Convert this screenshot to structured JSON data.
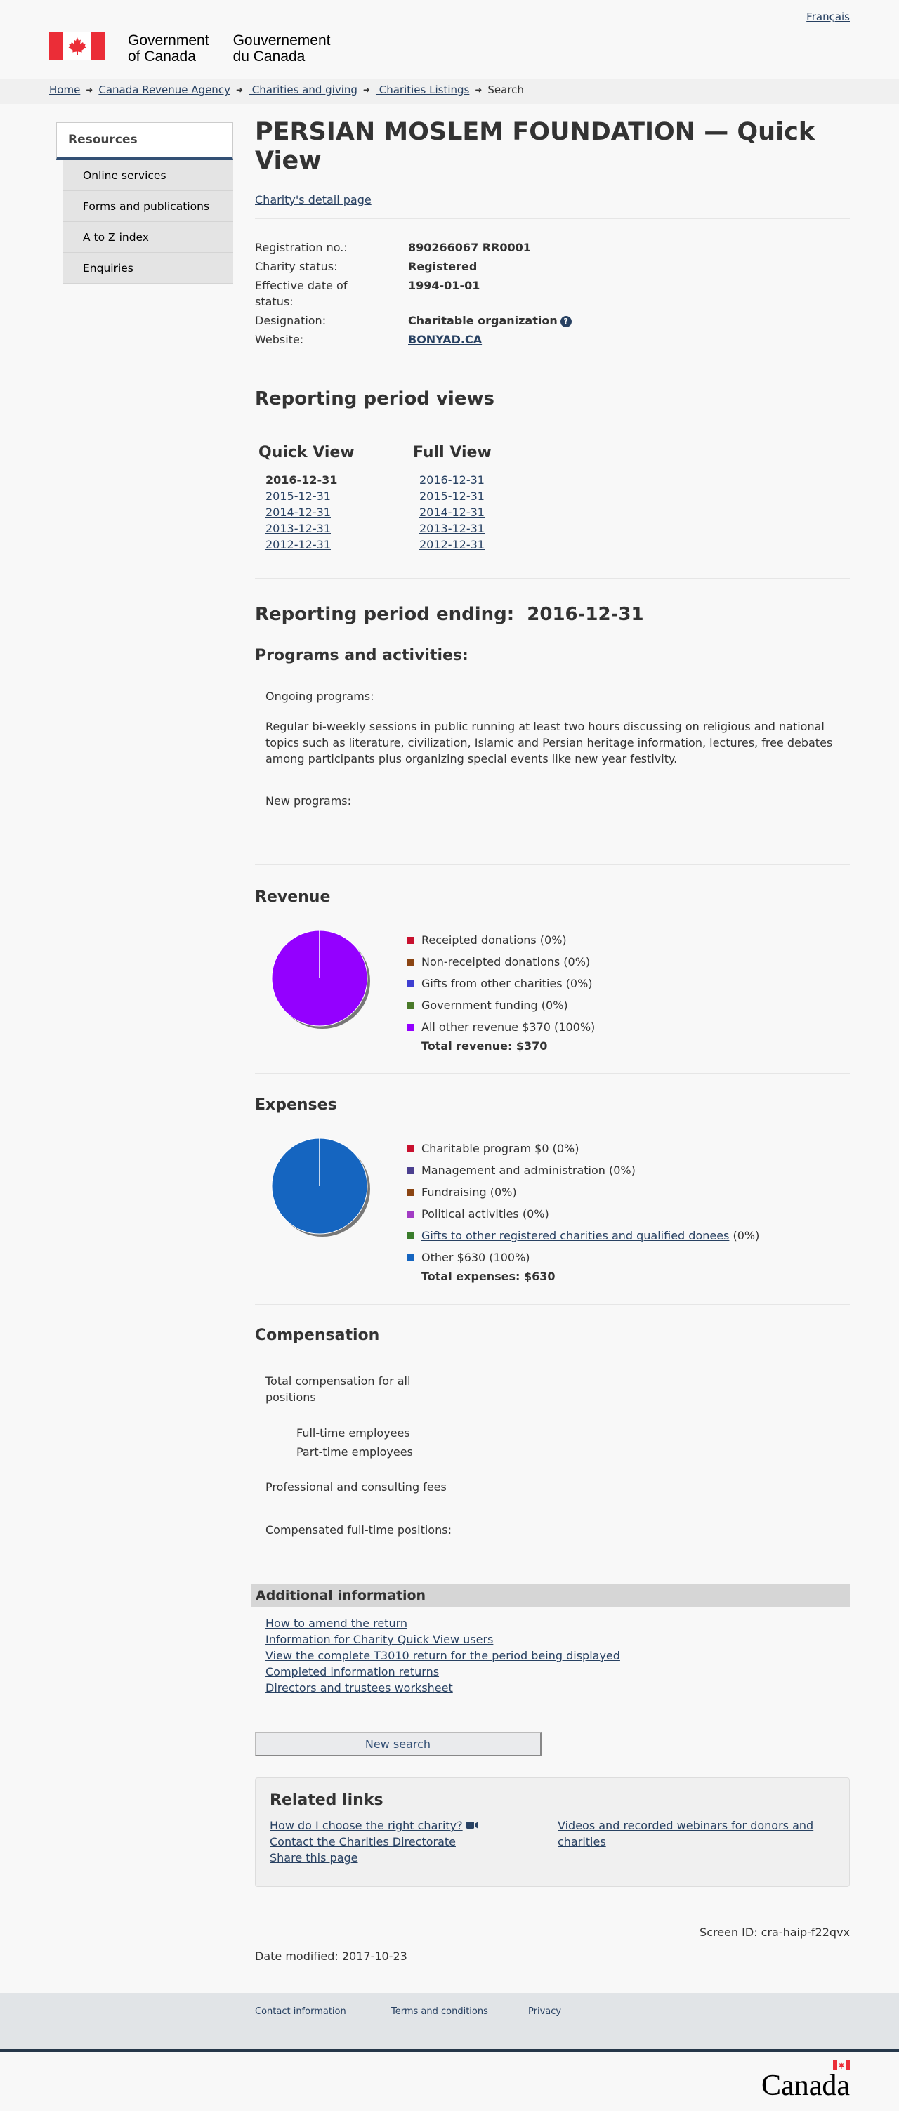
{
  "header": {
    "language_link": "Français",
    "signature_en_line1": "Government",
    "signature_en_line2": "of Canada",
    "signature_fr_line1": "Gouvernement",
    "signature_fr_line2": "du Canada",
    "flag_red": "#eb2d37"
  },
  "breadcrumb": {
    "items": [
      "Home",
      "Canada Revenue Agency",
      " Charities and giving",
      " Charities Listings"
    ],
    "current": "Search"
  },
  "sidebar": {
    "heading": "Resources",
    "items": [
      "Online services",
      "Forms and publications",
      "A to Z index",
      "Enquiries"
    ]
  },
  "page": {
    "title": "PERSIAN MOSLEM FOUNDATION — Quick View",
    "detail_link": "Charity's detail page"
  },
  "details": {
    "registration_label": "Registration no.:",
    "registration_value": "890266067 RR0001",
    "status_label": "Charity status:",
    "status_value": "Registered",
    "effective_label": "Effective date of status:",
    "effective_value": "1994-01-01",
    "designation_label": "Designation:",
    "designation_value": "Charitable organization",
    "website_label": "Website:",
    "website_value": "BONYAD.CA"
  },
  "reporting_views": {
    "heading": "Reporting period views",
    "quick_heading": "Quick View",
    "full_heading": "Full View",
    "quick_current": "2016-12-31",
    "quick_links": [
      "2015-12-31",
      "2014-12-31",
      "2013-12-31",
      "2012-12-31"
    ],
    "full_links": [
      "2016-12-31",
      "2015-12-31",
      "2014-12-31",
      "2013-12-31",
      "2012-12-31"
    ]
  },
  "period": {
    "heading": "Reporting period ending:  2016-12-31",
    "programs_heading": "Programs and activities:",
    "ongoing_label": "Ongoing programs:",
    "ongoing_text": "Regular bi-weekly sessions in public running at least two hours discussing on religious and national topics such as literature, civilization, Islamic and Persian heritage information, lectures, free debates among participants plus organizing special events like new year festivity.",
    "new_label": "New programs:"
  },
  "revenue": {
    "heading": "Revenue",
    "legend": [
      {
        "label": "Receipted donations (0%)",
        "color": "#c8102e"
      },
      {
        "label": "Non-receipted donations (0%)",
        "color": "#8b4513"
      },
      {
        "label": "Gifts from other charities (0%)",
        "color": "#3f3fd1"
      },
      {
        "label": "Government funding (0%)",
        "color": "#4a7a2a"
      },
      {
        "label": "All other revenue $370 (100%)",
        "color": "#9400ff"
      }
    ],
    "total": "Total revenue: $370"
  },
  "expenses": {
    "heading": "Expenses",
    "legend": [
      {
        "label": "Charitable program $0 (0%)",
        "color": "#c8102e"
      },
      {
        "label": "Management and administration (0%)",
        "color": "#4b3f8f"
      },
      {
        "label": "Fundraising (0%)",
        "color": "#8b4513"
      },
      {
        "label": "Political activities (0%)",
        "color": "#a23cc4"
      },
      {
        "link": "Gifts to other registered charities and qualified donees",
        "suffix": " (0%)",
        "color": "#3a7d2c"
      },
      {
        "label": "Other $630 (100%)",
        "color": "#1565c0"
      }
    ],
    "total": "Total expenses: $630"
  },
  "chart_data": [
    {
      "type": "pie",
      "categories": [
        "Receipted donations",
        "Non-receipted donations",
        "Gifts from other charities",
        "Government funding",
        "All other revenue"
      ],
      "values": [
        0,
        0,
        0,
        0,
        370
      ],
      "colors": [
        "#c8102e",
        "#8b4513",
        "#3f3fd1",
        "#4a7a2a",
        "#9400ff"
      ]
    },
    {
      "type": "pie",
      "categories": [
        "Charitable program",
        "Management and administration",
        "Fundraising",
        "Political activities",
        "Gifts to other registered charities and qualified donees",
        "Other"
      ],
      "values": [
        0,
        0,
        0,
        0,
        0,
        630
      ],
      "colors": [
        "#c8102e",
        "#4b3f8f",
        "#8b4513",
        "#a23cc4",
        "#3a7d2c",
        "#1565c0"
      ]
    }
  ],
  "compensation": {
    "heading": "Compensation",
    "total_label": "Total compensation for all positions",
    "full_time": "Full-time employees",
    "part_time": "Part-time employees",
    "fees": "Professional and consulting fees",
    "positions": "Compensated full-time positions:"
  },
  "additional": {
    "heading": "Additional information",
    "links": [
      "How to amend the return",
      "Information for Charity Quick View users",
      "View the complete T3010 return for the period being displayed",
      "Completed information returns",
      "Directors and trustees worksheet"
    ]
  },
  "new_search": "New search",
  "related": {
    "heading": "Related links",
    "left": [
      "How do I choose the right charity?",
      "Contact the Charities Directorate",
      "Share this page"
    ],
    "right": "Videos and recorded webinars for donors and charities"
  },
  "screen_id": "Screen ID: cra-haip-f22qvx",
  "date_modified": "Date modified: 2017-10-23",
  "footer": {
    "links": [
      "Contact information",
      "Terms and conditions",
      "Privacy"
    ],
    "wordmark": "Canada"
  }
}
